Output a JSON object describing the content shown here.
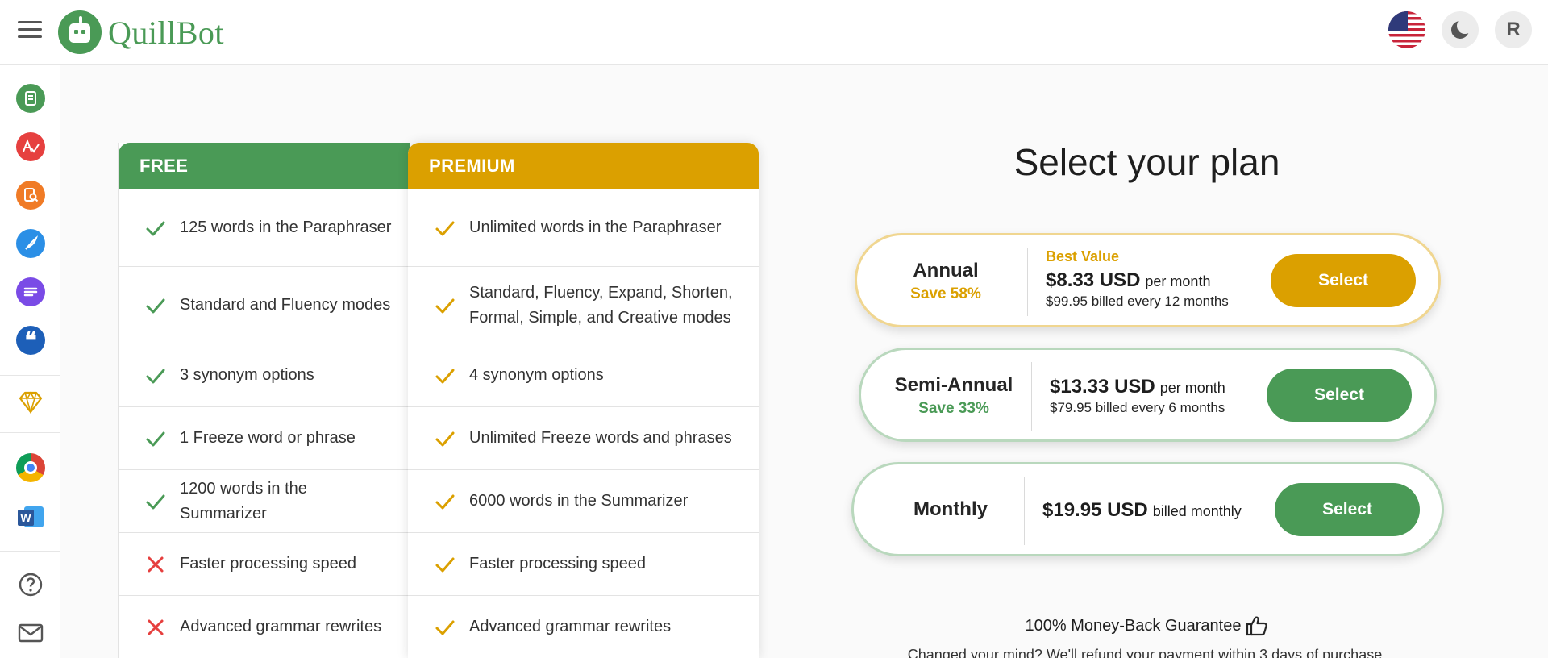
{
  "header": {
    "brand": "QuillBot",
    "avatar_initial": "R",
    "icons": [
      "menu-icon",
      "us-flag-icon",
      "dark-mode-icon"
    ]
  },
  "sidebar": {
    "items": [
      {
        "name": "paraphraser",
        "icon": "paraphraser-icon",
        "color": "#4a9a56"
      },
      {
        "name": "grammar-checker",
        "icon": "grammar-checker-icon",
        "color": "#e6403f"
      },
      {
        "name": "plagiarism-checker",
        "icon": "plagiarism-checker-icon",
        "color": "#f07b26"
      },
      {
        "name": "co-writer",
        "icon": "co-writer-icon",
        "color": "#2b8fe6"
      },
      {
        "name": "summarizer",
        "icon": "summarizer-icon",
        "color": "#7a4be6"
      },
      {
        "name": "citation-generator",
        "icon": "citation-generator-icon",
        "color": "#1d5fb8"
      },
      {
        "name": "premium",
        "icon": "diamond-icon",
        "color": "#dba000"
      },
      {
        "name": "chrome-extension",
        "icon": "chrome-icon",
        "color": "#4285f4"
      },
      {
        "name": "word-addin",
        "icon": "word-icon",
        "color": "#2b579a"
      },
      {
        "name": "help",
        "icon": "help-icon",
        "color": "#555555"
      },
      {
        "name": "contact",
        "icon": "mail-icon",
        "color": "#555555"
      }
    ]
  },
  "comparison": {
    "free_label": "FREE",
    "premium_label": "PREMIUM",
    "rows": [
      {
        "free": "125 words in the Paraphraser",
        "free_included": true,
        "premium": "Unlimited words in the Paraphraser"
      },
      {
        "free": "Standard and Fluency modes",
        "free_included": true,
        "premium": "Standard, Fluency, Expand, Shorten, Formal, Simple, and Creative modes"
      },
      {
        "free": "3 synonym options",
        "free_included": true,
        "premium": "4 synonym options"
      },
      {
        "free": "1 Freeze word or phrase",
        "free_included": true,
        "premium": "Unlimited Freeze words and phrases"
      },
      {
        "free": "1200 words in the Summarizer",
        "free_included": true,
        "premium": "6000 words in the Summarizer"
      },
      {
        "free": "Faster processing speed",
        "free_included": false,
        "premium": "Faster processing speed"
      },
      {
        "free": "Advanced grammar rewrites",
        "free_included": false,
        "premium": "Advanced grammar rewrites"
      }
    ]
  },
  "plans": {
    "title": "Select your plan",
    "annual": {
      "name": "Annual",
      "save": "Save 58%",
      "best": "Best Value",
      "price": "$8.33 USD",
      "unit": "per month",
      "billed": "$99.95 billed every 12 months",
      "button": "Select"
    },
    "semi": {
      "name": "Semi-Annual",
      "save": "Save 33%",
      "price": "$13.33 USD",
      "unit": "per month",
      "billed": "$79.95 billed every 6 months",
      "button": "Select"
    },
    "monthly": {
      "name": "Monthly",
      "price": "$19.95 USD",
      "unit": "billed monthly",
      "button": "Select"
    },
    "guarantee": "100% Money-Back Guarantee",
    "guarantee_sub": "Changed your mind? We'll refund your payment within 3 days of purchase."
  },
  "colors": {
    "brand_green": "#4a9a56",
    "premium_gold": "#dba000",
    "cross_red": "#e6403f"
  }
}
